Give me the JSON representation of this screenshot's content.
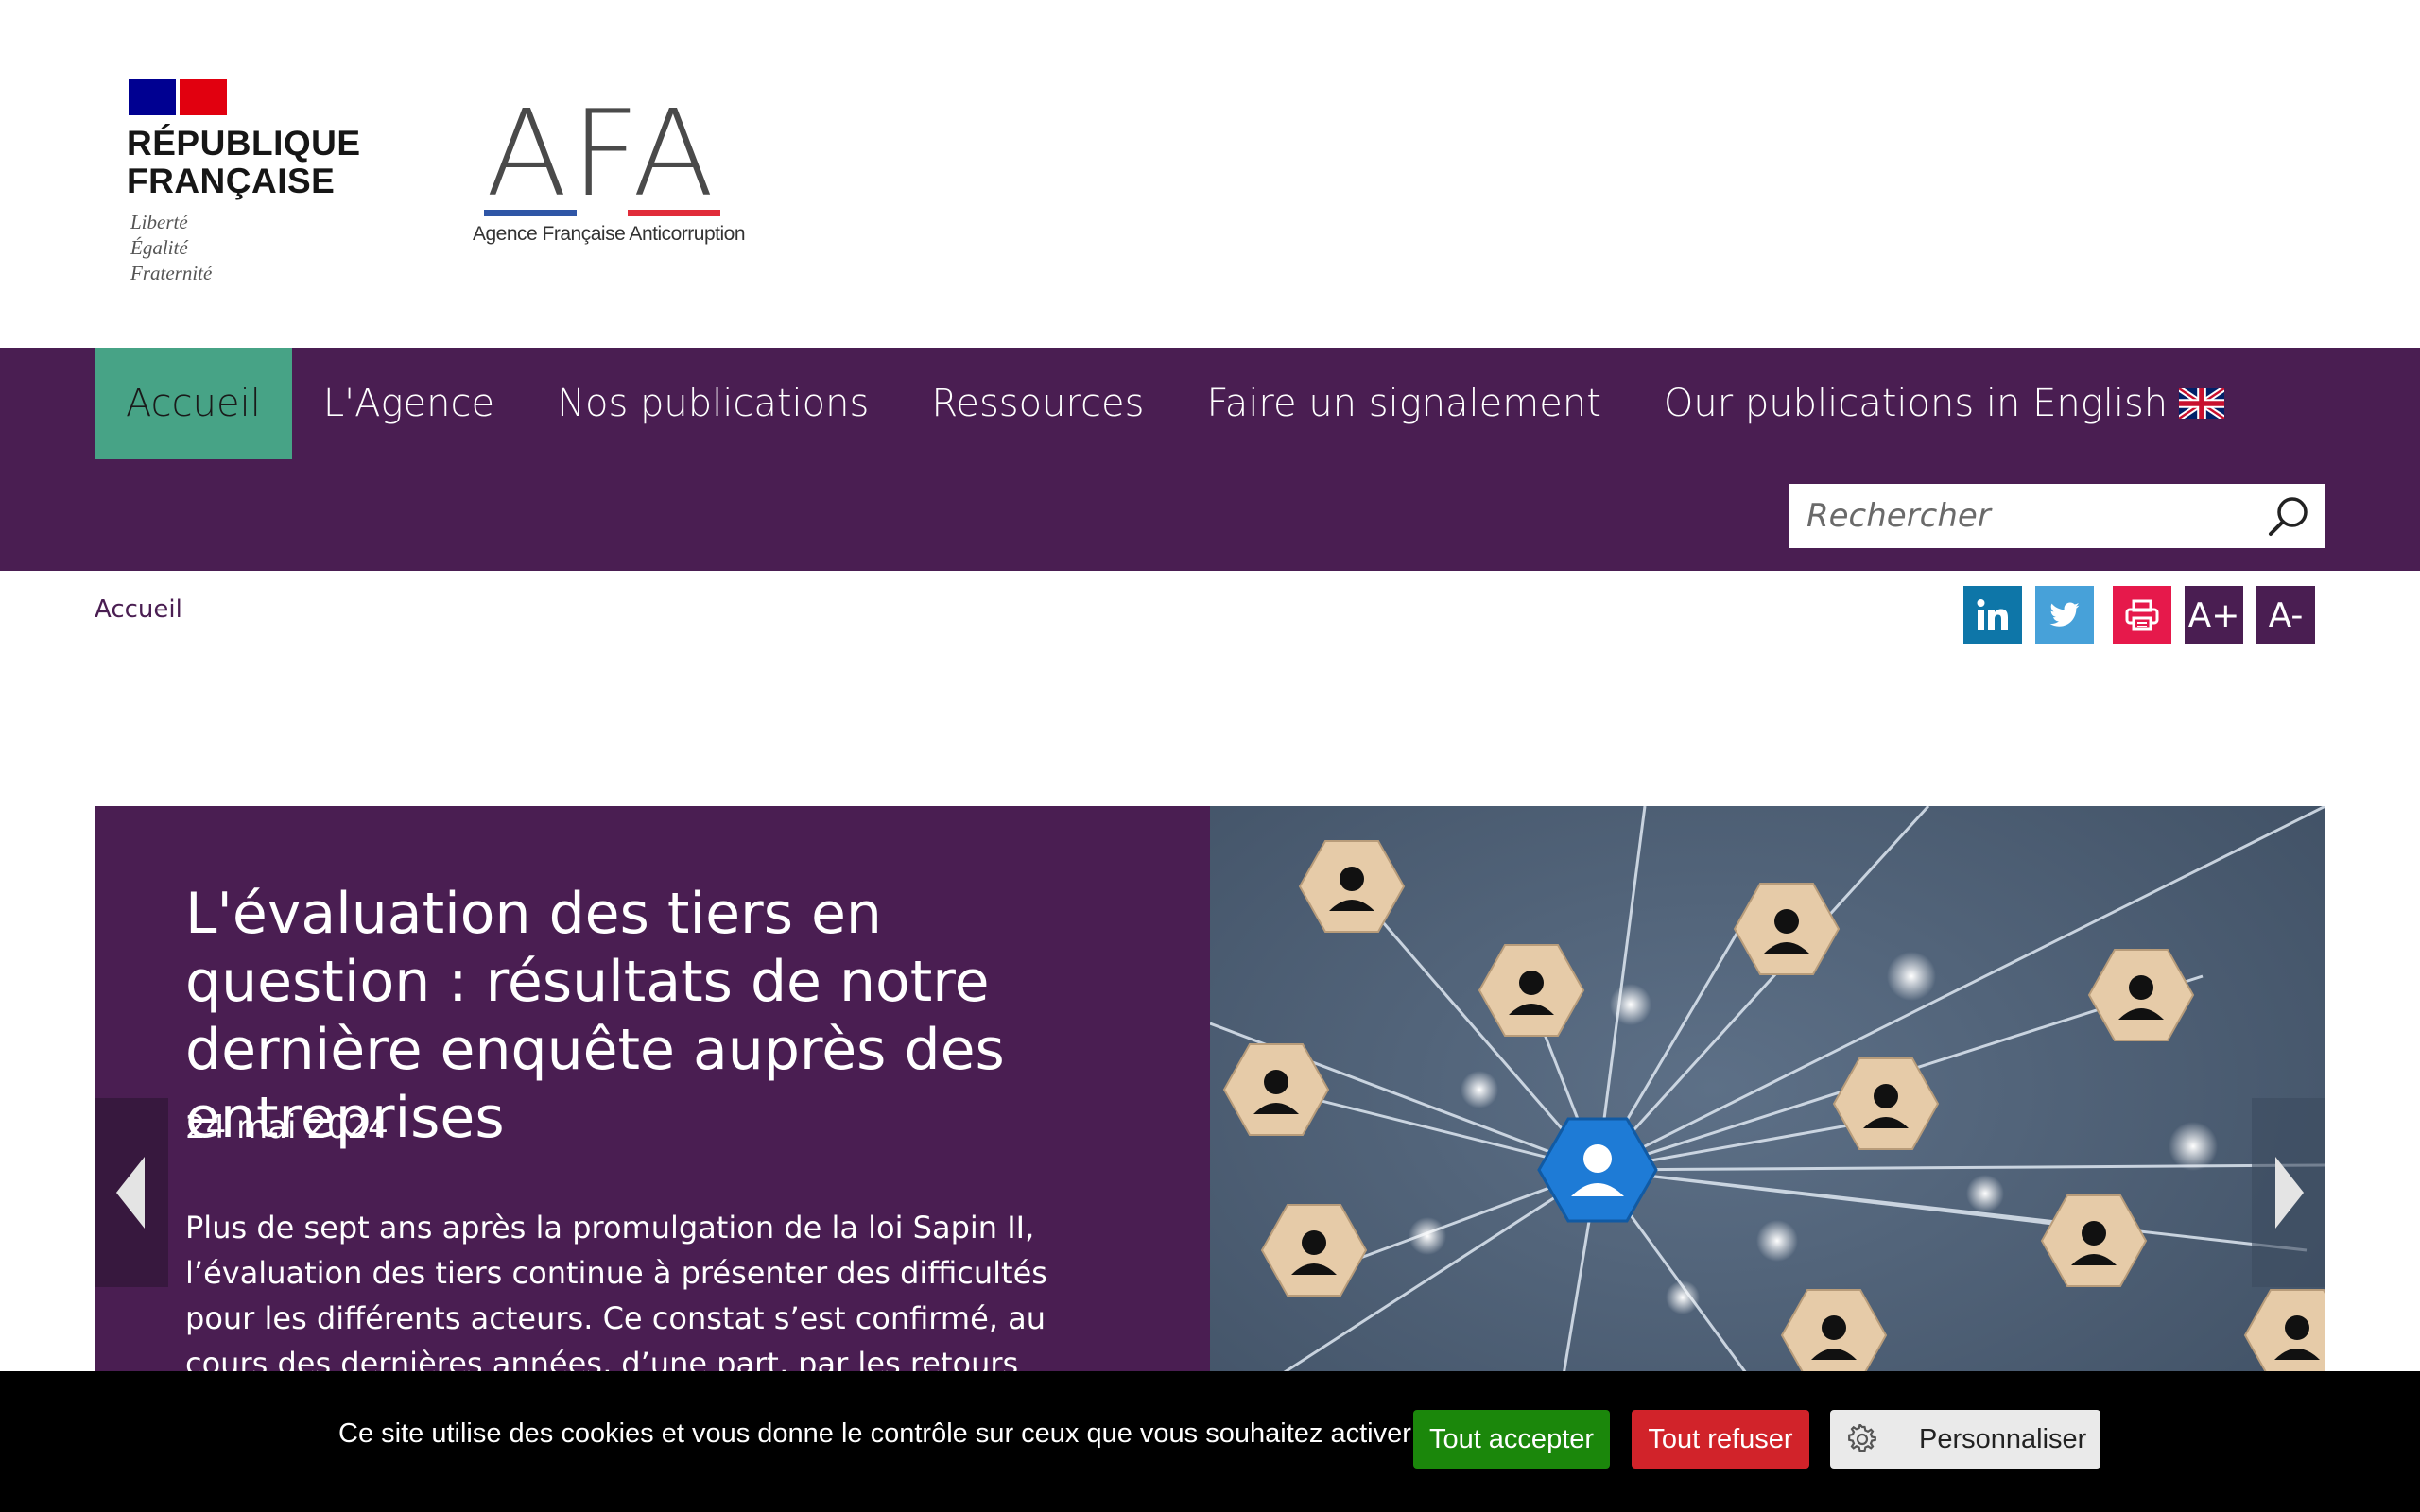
{
  "header": {
    "republique": {
      "title": "RÉPUBLIQUE\nFRANÇAISE",
      "motto": "Liberté\nÉgalité\nFraternité"
    },
    "agency": {
      "logo_letters": "AFA",
      "subtitle": "Agence Française Anticorruption"
    }
  },
  "nav": {
    "items": [
      {
        "label": "Accueil",
        "active": true
      },
      {
        "label": "L'Agence"
      },
      {
        "label": "Nos publications"
      },
      {
        "label": "Ressources"
      },
      {
        "label": "Faire un signalement"
      },
      {
        "label": "Our publications in English",
        "icon": "uk-flag-icon"
      }
    ],
    "search": {
      "placeholder": "Rechercher",
      "icon": "search-icon"
    }
  },
  "breadcrumb": {
    "current": "Accueil"
  },
  "tools": {
    "linkedin_icon": "linkedin-icon",
    "twitter_icon": "twitter-icon",
    "print_icon": "print-icon",
    "font_increase": "A+",
    "font_decrease": "A-"
  },
  "slide": {
    "title": "L'évaluation des tiers en question : résultats de notre dernière enquête auprès des entreprises",
    "date": "24 mai 2024",
    "excerpt": "Plus de sept ans après la promulgation de la loi Sapin II, l’évaluation des tiers continue à présenter des difficultés pour les différents acteurs. Ce constat s’est confirmé, au cours des dernières années, d’une part, par les retours d’expérience",
    "image": "network-of-people-hexagons-image"
  },
  "cookie": {
    "text": "Ce site utilise des cookies et vous donne le contrôle sur ceux que vous souhaitez activer",
    "accept": "Tout accepter",
    "refuse": "Tout refuser",
    "customize": "Personnaliser"
  },
  "colors": {
    "brand_purple": "#4a1e52",
    "active_green": "#47a386",
    "accept_green": "#1b870b",
    "refuse_red": "#d1232a"
  }
}
